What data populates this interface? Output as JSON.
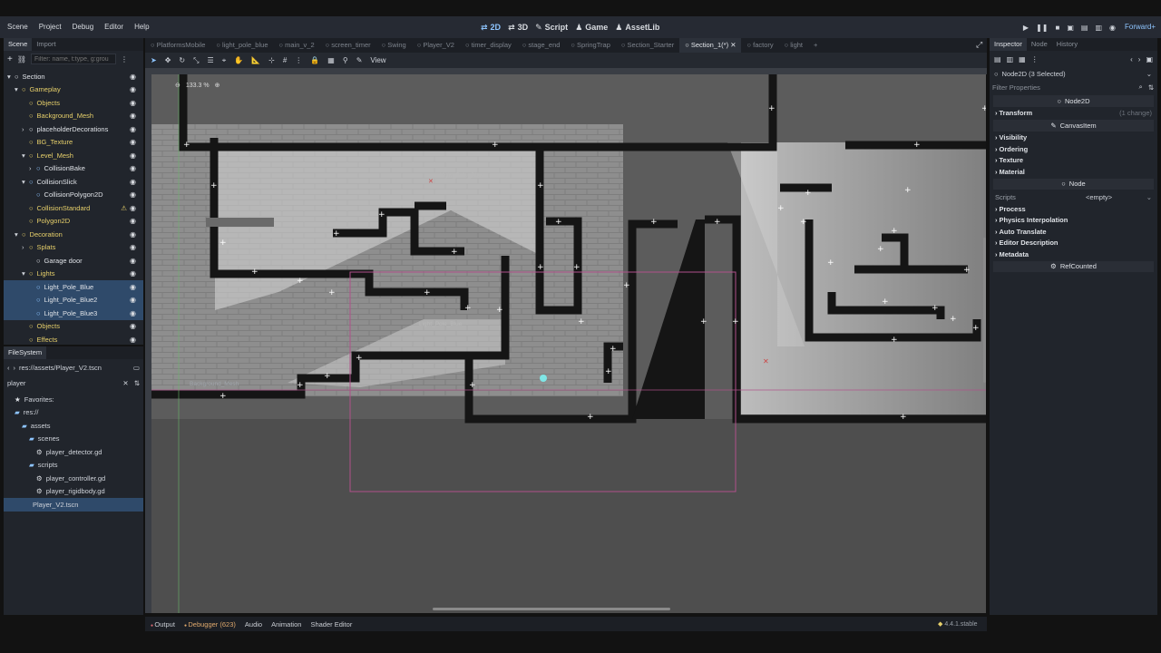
{
  "menus": [
    "Scene",
    "Project",
    "Debug",
    "Editor",
    "Help"
  ],
  "workspaces": [
    {
      "icon": "⇄",
      "label": "2D",
      "active": true
    },
    {
      "icon": "⇄",
      "label": "3D"
    },
    {
      "icon": "✎",
      "label": "Script"
    },
    {
      "icon": "♟",
      "label": "Game"
    },
    {
      "icon": "♟",
      "label": "AssetLib"
    }
  ],
  "renderer": "Forward+",
  "scene_dock": {
    "tabs": [
      "Scene",
      "Import"
    ],
    "filter_placeholder": "Filter: name, t:type, g:grou",
    "tree": [
      {
        "label": "Section",
        "indent": 0,
        "color": "white",
        "arrow": "▾"
      },
      {
        "label": "Gameplay",
        "indent": 1,
        "color": "yellow",
        "arrow": "▾"
      },
      {
        "label": "Objects",
        "indent": 2,
        "color": "yellow",
        "arrow": ""
      },
      {
        "label": "Background_Mesh",
        "indent": 2,
        "color": "yellow",
        "arrow": ""
      },
      {
        "label": "placeholderDecorations",
        "indent": 2,
        "color": "white",
        "arrow": "›"
      },
      {
        "label": "BG_Texture",
        "indent": 2,
        "color": "yellow",
        "arrow": ""
      },
      {
        "label": "Level_Mesh",
        "indent": 2,
        "color": "yellow",
        "arrow": "▾"
      },
      {
        "label": "CollisionBake",
        "indent": 3,
        "color": "blue",
        "arrow": "›"
      },
      {
        "label": "CollisionSlick",
        "indent": 2,
        "color": "blue",
        "arrow": "▾"
      },
      {
        "label": "CollisionPolygon2D",
        "indent": 3,
        "color": "blue",
        "arrow": ""
      },
      {
        "label": "CollisionStandard",
        "indent": 2,
        "color": "yellow",
        "arrow": "",
        "warn": true
      },
      {
        "label": "Polygon2D",
        "indent": 2,
        "color": "yellow",
        "arrow": ""
      },
      {
        "label": "Decoration",
        "indent": 1,
        "color": "yellow",
        "arrow": "▾"
      },
      {
        "label": "Splats",
        "indent": 2,
        "color": "yellow",
        "arrow": "›"
      },
      {
        "label": "Garage door",
        "indent": 3,
        "color": "white",
        "arrow": ""
      },
      {
        "label": "Lights",
        "indent": 2,
        "color": "yellow",
        "arrow": "▾"
      },
      {
        "label": "Light_Pole_Blue",
        "indent": 3,
        "color": "blue",
        "arrow": "",
        "sel": true
      },
      {
        "label": "Light_Pole_Blue2",
        "indent": 3,
        "color": "blue",
        "arrow": "",
        "sel": true
      },
      {
        "label": "Light_Pole_Blue3",
        "indent": 3,
        "color": "blue",
        "arrow": "",
        "sel": true
      },
      {
        "label": "Objects",
        "indent": 2,
        "color": "yellow",
        "arrow": ""
      },
      {
        "label": "Effects",
        "indent": 2,
        "color": "yellow",
        "arrow": ""
      }
    ]
  },
  "filesystem": {
    "title": "FileSystem",
    "path": "res://assets/Player_V2.tscn",
    "search": "player",
    "items": [
      {
        "label": "Favorites:",
        "indent": 1,
        "icon": "★"
      },
      {
        "label": "res://",
        "indent": 1,
        "icon": "▰"
      },
      {
        "label": "assets",
        "indent": 2,
        "icon": "▰"
      },
      {
        "label": "scenes",
        "indent": 3,
        "icon": "▰"
      },
      {
        "label": "player_detector.gd",
        "indent": 4,
        "icon": "⚙"
      },
      {
        "label": "scripts",
        "indent": 3,
        "icon": "▰"
      },
      {
        "label": "player_controller.gd",
        "indent": 4,
        "icon": "⚙"
      },
      {
        "label": "player_rigidbody.gd",
        "indent": 4,
        "icon": "⚙"
      },
      {
        "label": "Player_V2.tscn",
        "indent": 3,
        "icon": "",
        "sel": true
      }
    ]
  },
  "scene_tabs": [
    "PlatformsMobile",
    "light_pole_blue",
    "main_v_2",
    "screen_timer",
    "Swing",
    "Player_V2",
    "timer_display",
    "stage_end",
    "SpringTrap",
    "Section_Starter",
    "Section_1(*)",
    "factory",
    "light"
  ],
  "active_scene_tab": "Section_1(*)",
  "toolbar": {
    "view_label": "View"
  },
  "viewport": {
    "zoom": "133.3 %",
    "labels": [
      "Background_Mesh",
      "Light_Pole_Blue",
      "Light_Pole_Blue"
    ]
  },
  "bottom_tabs": [
    {
      "label": "Output",
      "dot": "#e06c75"
    },
    {
      "label": "Debugger (623)",
      "dot": "#e0a96c",
      "color": "#e0a96c"
    },
    {
      "label": "Audio"
    },
    {
      "label": "Animation"
    },
    {
      "label": "Shader Editor"
    }
  ],
  "version": "4.4.1.stable",
  "inspector": {
    "tabs": [
      "Inspector",
      "Node",
      "History"
    ],
    "selection": "Node2D (3 Selected)",
    "filter_placeholder": "Filter Properties",
    "class_node2d": "Node2D",
    "transform": "Transform",
    "transform_note": "(1 change)",
    "class_canvasitem": "CanvasItem",
    "canvas_sections": [
      "Visibility",
      "Ordering",
      "Texture",
      "Material"
    ],
    "class_node": "Node",
    "scripts_label": "Scripts",
    "scripts_value": "<empty>",
    "node_sections": [
      "Process",
      "Physics Interpolation",
      "Auto Translate",
      "Editor Description",
      "Metadata"
    ],
    "refcounted": "RefCounted"
  }
}
